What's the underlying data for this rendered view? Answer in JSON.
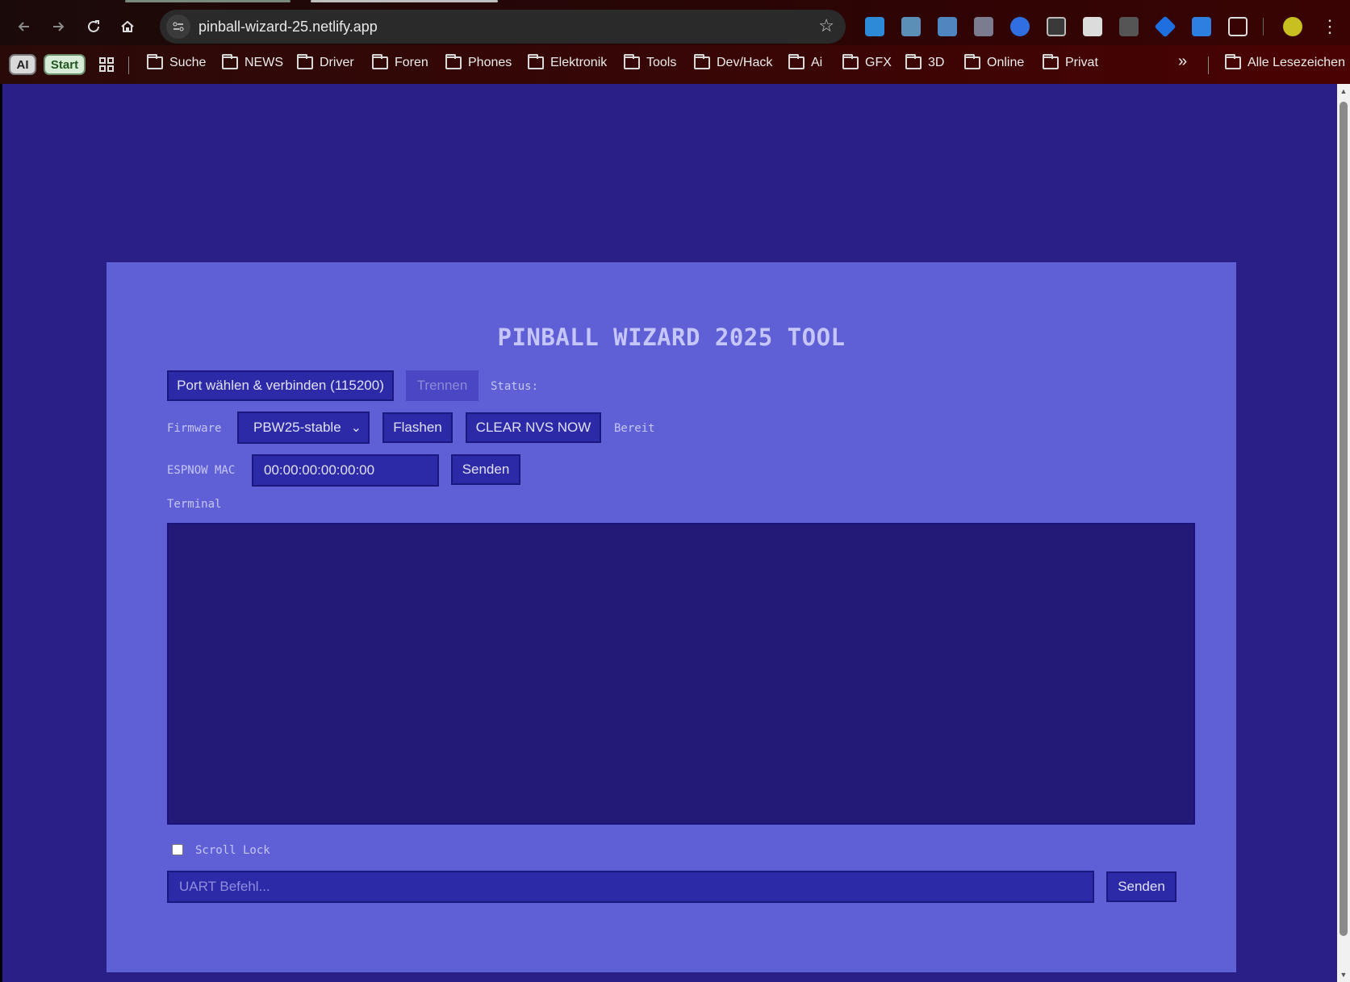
{
  "browser": {
    "url": "pinball-wizard-25.netlify.app",
    "bookmark_pills": [
      "AI",
      "Start"
    ],
    "bookmarks": [
      "Suche",
      "NEWS",
      "Driver",
      "Foren",
      "Phones",
      "Elektronik",
      "Tools",
      "Dev/Hack",
      "Ai",
      "GFX",
      "3D",
      "Online",
      "Privat"
    ],
    "all_bookmarks": "Alle Lesezeichen",
    "overflow": "»"
  },
  "app": {
    "title": "PINBALL WIZARD 2025 TOOL",
    "connect_button": "Port wählen & verbinden (115200)",
    "disconnect_button": "Trennen",
    "status_label": "Status:",
    "status_value": "",
    "firmware_label": "Firmware",
    "firmware_selected": "PBW25-stable",
    "flash_button": "Flashen",
    "clear_nvs_button": "CLEAR NVS NOW",
    "firmware_status": "Bereit",
    "espnow_label": "ESPNOW MAC",
    "espnow_value": "00:00:00:00:00:00",
    "espnow_send_button": "Senden",
    "terminal_label": "Terminal",
    "terminal_content": "",
    "scroll_lock_label": "Scroll Lock",
    "scroll_lock_checked": false,
    "uart_placeholder": "UART Befehl...",
    "uart_send_button": "Senden"
  },
  "colors": {
    "page_bg": "#291f87",
    "card_bg": "#5f5fd6",
    "control_bg": "#2d2aa8",
    "terminal_bg": "#221a76",
    "text_light": "#c6c6ff"
  }
}
